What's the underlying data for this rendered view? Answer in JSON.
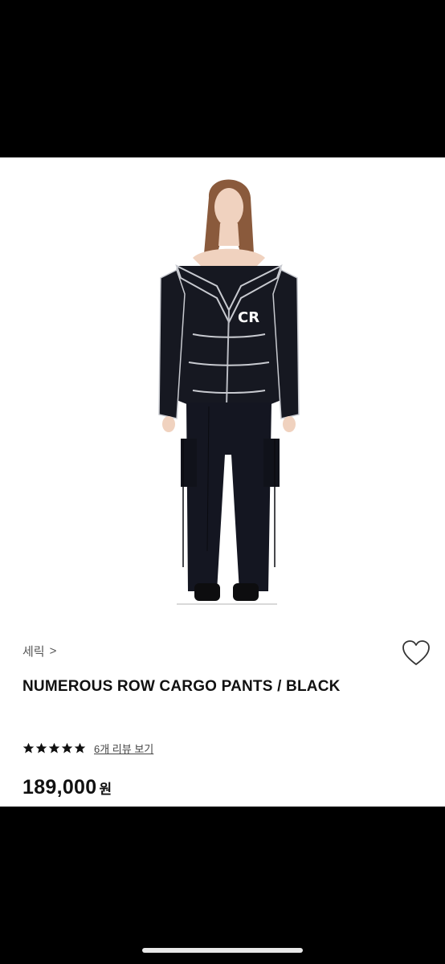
{
  "product": {
    "brand": "세릭",
    "brand_chevron": ">",
    "title": "NUMEROUS ROW CARGO PANTS / BLACK",
    "rating_stars": 5,
    "review_link": "6개 리뷰 보기",
    "price": "189,000",
    "currency": "원",
    "image_logo_text": "CR"
  },
  "icons": {
    "heart": "heart-outline-icon",
    "star": "star-filled-icon"
  },
  "colors": {
    "background_outer": "#000000",
    "content_background": "#ffffff",
    "text_primary": "#111111",
    "text_secondary": "#555555"
  }
}
